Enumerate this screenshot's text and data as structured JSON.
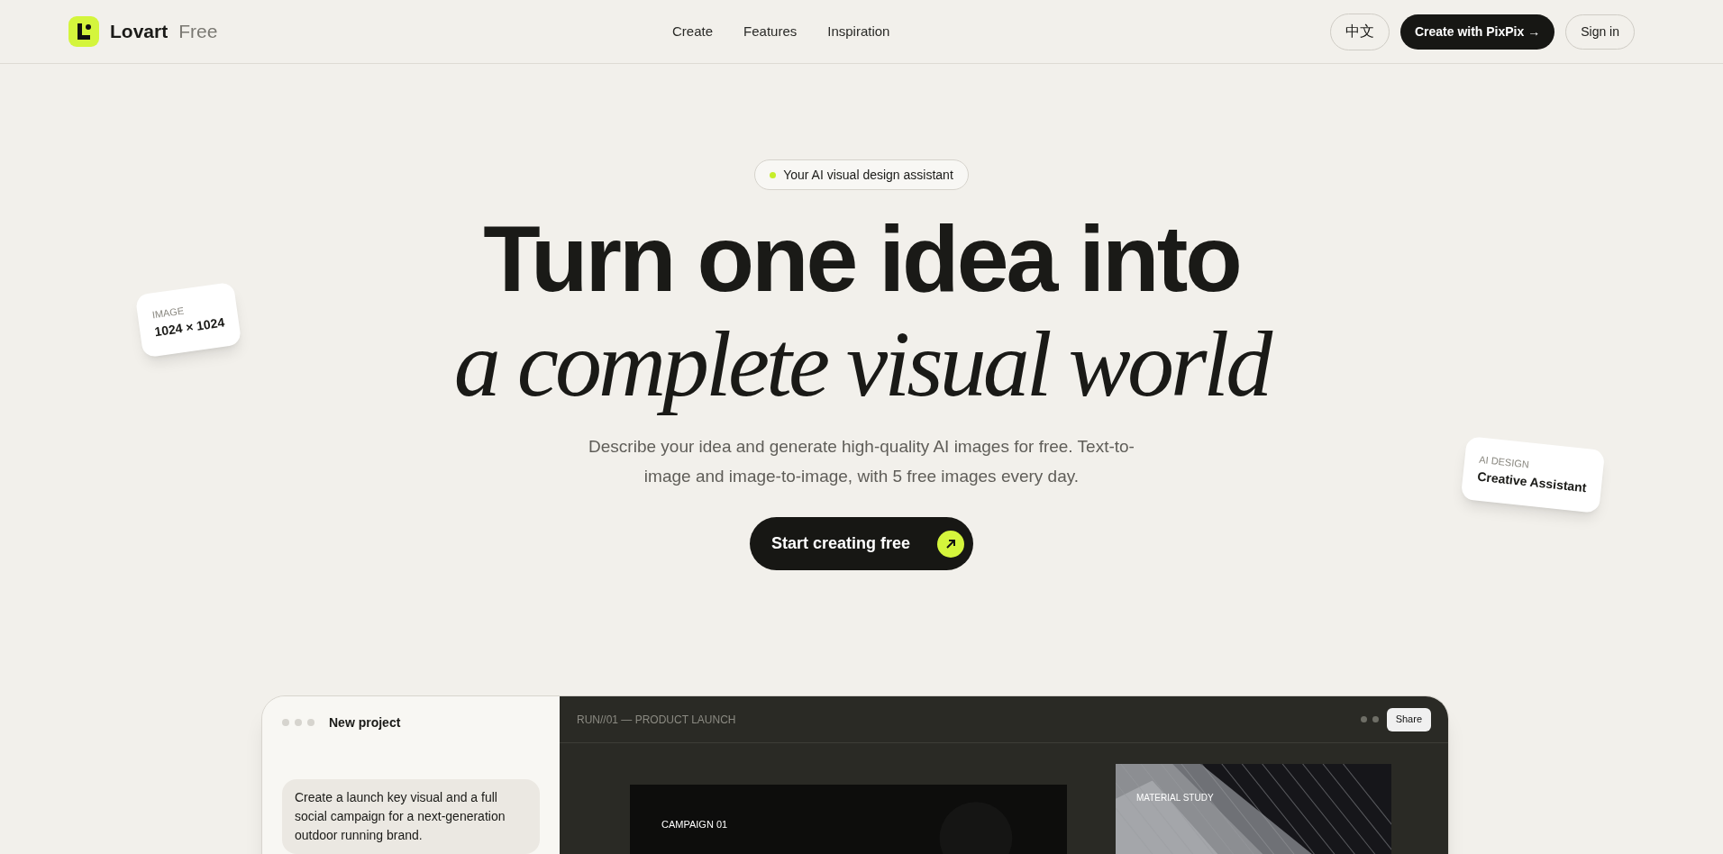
{
  "header": {
    "logo": {
      "brand": "Lovart",
      "suffix": "Free"
    },
    "nav": [
      {
        "label": "Create"
      },
      {
        "label": "Features"
      },
      {
        "label": "Inspiration"
      }
    ],
    "language": "中文",
    "primary_button": "Create with PixPix →",
    "sign_in": "Sign in"
  },
  "hero": {
    "badge": "Your AI visual design assistant",
    "headline": "Turn one idea into",
    "headline_italic": "a complete visual world",
    "description": "Describe your idea and generate high-quality AI images for free. Text-to-image and image-to-image, with 5 free images every day.",
    "cta": "Start creating free"
  },
  "floating_cards": [
    {
      "label": "IMAGE",
      "value": "1024 × 1024"
    },
    {
      "label": "AI DESIGN",
      "value": "Creative Assistant"
    }
  ],
  "preview": {
    "project_title": "New project",
    "prompt": "Create a launch key visual and a full social campaign for a next-generation outdoor running brand.",
    "run_title": "RUN//01 — PRODUCT LAUNCH",
    "share": "Share",
    "images": [
      {
        "kind": "picture",
        "caption": "CAMPAIGN 01"
      },
      {
        "kind": "picture",
        "caption": "MATERIAL STUDY"
      }
    ]
  }
}
